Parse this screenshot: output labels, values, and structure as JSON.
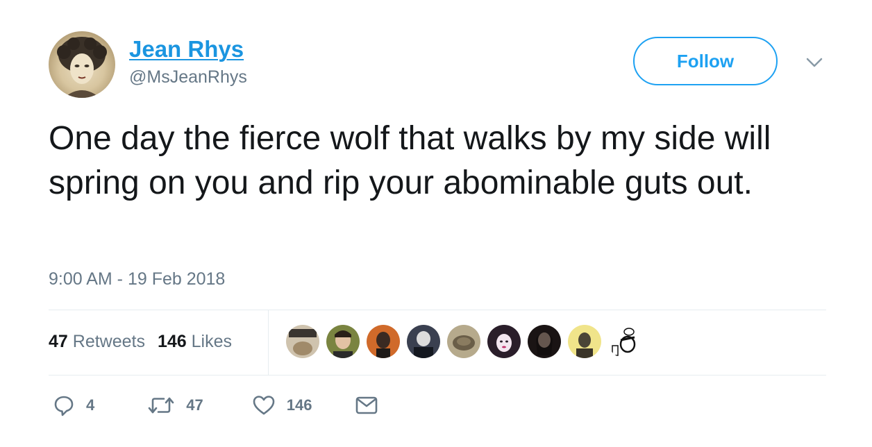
{
  "author": {
    "name": "Jean Rhys",
    "handle": "@MsJeanRhys"
  },
  "follow_label": "Follow",
  "tweet_text": "One day the fierce wolf that walks by my side will spring on you and rip your abominable guts out.",
  "timestamp": "9:00 AM - 19 Feb 2018",
  "stats": {
    "retweets_count": "47",
    "retweets_label": "Retweets",
    "likes_count": "146",
    "likes_label": "Likes"
  },
  "likers": [
    {
      "name": "liker-avatar-1",
      "color": "#b9a58a"
    },
    {
      "name": "liker-avatar-2",
      "color": "#6b7a3a"
    },
    {
      "name": "liker-avatar-3",
      "color": "#c8642a"
    },
    {
      "name": "liker-avatar-4",
      "color": "#2b2f3a"
    },
    {
      "name": "liker-avatar-5",
      "color": "#9a8a6a"
    },
    {
      "name": "liker-avatar-6",
      "color": "#3a2a3a"
    },
    {
      "name": "liker-avatar-7",
      "color": "#2a1f1f"
    },
    {
      "name": "liker-avatar-8",
      "color": "#e8dc7a"
    },
    {
      "name": "liker-avatar-9",
      "color": "#f2f2f2"
    }
  ],
  "actions": {
    "replies": "4",
    "retweets": "47",
    "likes": "146"
  },
  "colors": {
    "link_blue": "#1b95e0",
    "brand_blue": "#1da1f2",
    "secondary_text": "#657786",
    "divider": "#e6ecf0"
  }
}
